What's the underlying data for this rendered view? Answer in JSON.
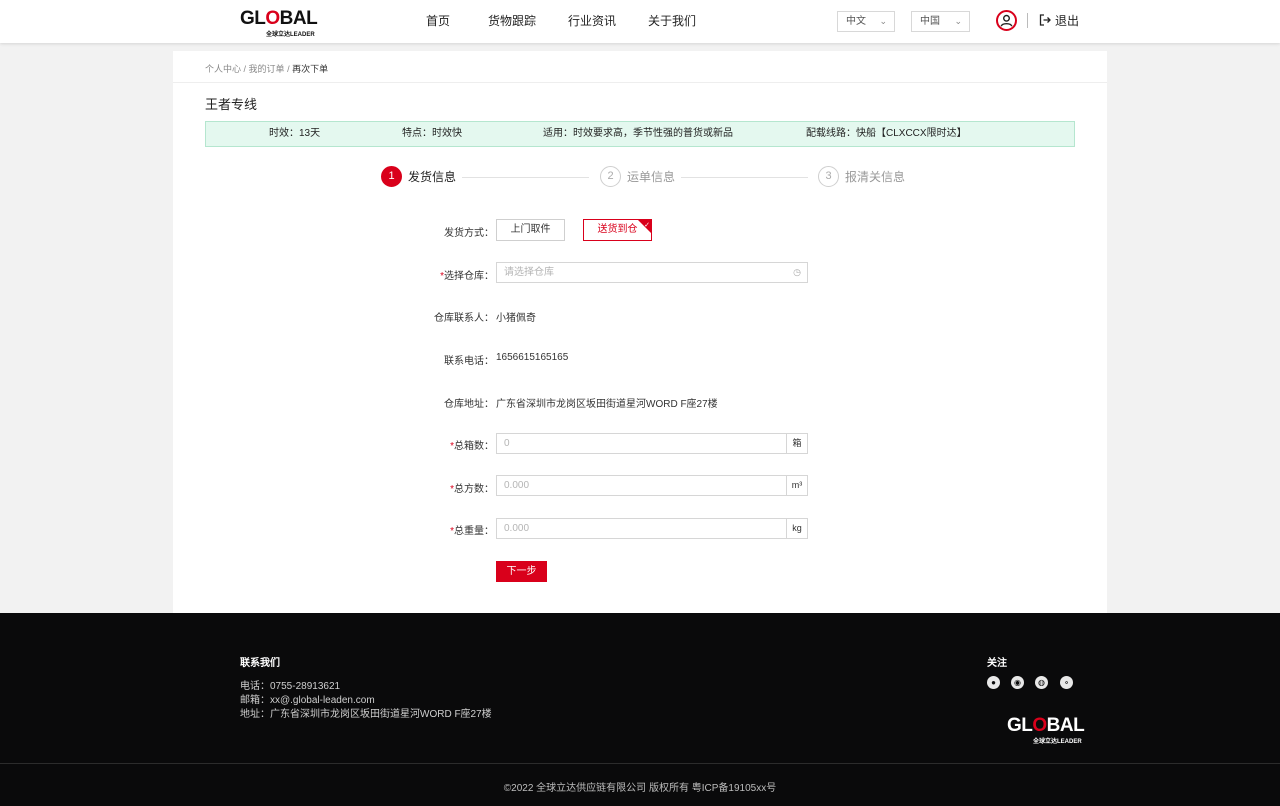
{
  "header": {
    "logo_text_left": "GL",
    "logo_text_o": "O",
    "logo_text_right": "BAL",
    "logo_sub": "全球立达LEADER",
    "nav": [
      "首页",
      "货物跟踪",
      "行业资讯",
      "关于我们"
    ],
    "language_select": "中文",
    "region_select": "中国",
    "logout_label": "退出"
  },
  "breadcrumb": [
    "个人中心",
    "我的订单",
    "再次下单"
  ],
  "page_title": "王者专线",
  "info_bar": {
    "timeliness": "时效：13天",
    "feature": "特点：时效快",
    "suitable": "适用：时效要求高，季节性强的普货或新品",
    "route": "配载线路：快船【CLXCCX限时达】"
  },
  "steps": [
    {
      "num": "1",
      "label": "发货信息"
    },
    {
      "num": "2",
      "label": "运单信息"
    },
    {
      "num": "3",
      "label": "报清关信息"
    }
  ],
  "form": {
    "ship_method_label": "发货方式：",
    "ship_options": [
      "上门取件",
      "送货到仓"
    ],
    "warehouse_label": "选择仓库：",
    "warehouse_placeholder": "请选择仓库",
    "contact_label": "仓库联系人：",
    "contact_value": "小猪佩奇",
    "phone_label": "联系电话：",
    "phone_value": "1656615165165",
    "address_label": "仓库地址：",
    "address_value": "广东省深圳市龙岗区坂田街道星河WORD F座27楼",
    "boxes_label": "总箱数：",
    "boxes_placeholder": "0",
    "boxes_unit": "箱",
    "volume_label": "总方数：",
    "volume_placeholder": "0.000",
    "volume_unit": "m³",
    "weight_label": "总重量：",
    "weight_placeholder": "0.000",
    "weight_unit": "kg",
    "next_label": "下一步"
  },
  "footer": {
    "contact_title": "联系我们",
    "phone": "电话：0755-28913621",
    "email": "邮箱：xx@.global-leaden.com",
    "address": "地址：广东省深圳市龙岗区坂田街道星河WORD F座27楼",
    "follow_title": "关注",
    "social_icons": [
      "github-icon",
      "chrome-icon",
      "weibo-icon",
      "wechat-icon"
    ],
    "copyright": "©2022 全球立达供应链有限公司 版权所有 粤ICP备19105xx号"
  },
  "colors": {
    "brand_red": "#d9001b",
    "info_bg": "#e4f8ef",
    "footer_bg": "#0a0a0b"
  }
}
